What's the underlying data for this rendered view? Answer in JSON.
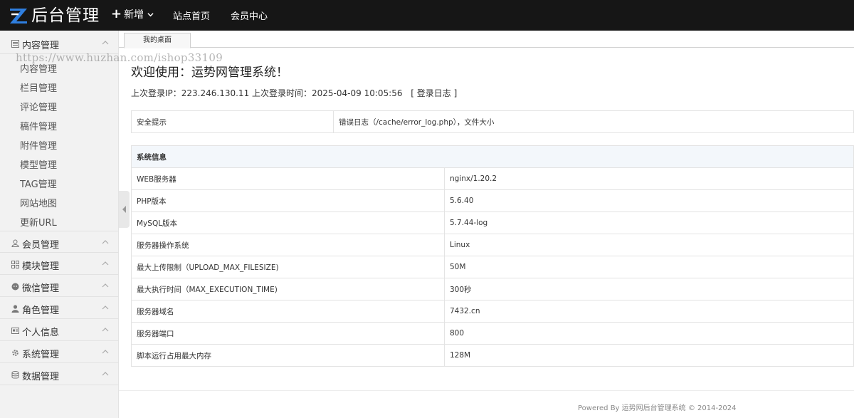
{
  "header": {
    "logo_text": "后台管理",
    "add_label": "新增",
    "nav_links": [
      "站点首页",
      "会员中心"
    ]
  },
  "sidebar": {
    "content_group": {
      "label": "内容管理",
      "icon": "grid-list-icon"
    },
    "content_items": [
      "内容管理",
      "栏目管理",
      "评论管理",
      "稿件管理",
      "附件管理",
      "模型管理",
      "TAG管理",
      "网站地图",
      "更新URL"
    ],
    "groups": [
      {
        "label": "会员管理",
        "icon": "user-icon"
      },
      {
        "label": "模块管理",
        "icon": "modules-icon"
      },
      {
        "label": "微信管理",
        "icon": "wechat-icon"
      },
      {
        "label": "角色管理",
        "icon": "person-icon"
      },
      {
        "label": "个人信息",
        "icon": "id-card-icon"
      },
      {
        "label": "系统管理",
        "icon": "gear-icon"
      },
      {
        "label": "数据管理",
        "icon": "database-icon"
      }
    ]
  },
  "tabs": {
    "active": "我的桌面"
  },
  "watermark": "https://www.huzhan.com/ishop33109",
  "main": {
    "welcome": "欢迎使用：运势网管理系统！",
    "login_info": "上次登录IP：223.246.130.11 上次登录时间：2025-04-09 10:05:56",
    "login_log_link": "[ 登录日志 ]",
    "security": {
      "label": "安全提示",
      "value": "错误日志（/cache/error_log.php），文件大小"
    },
    "sysinfo_title": "系统信息",
    "sysinfo_rows": [
      {
        "k": "WEB服务器",
        "v": "nginx/1.20.2"
      },
      {
        "k": "PHP版本",
        "v": "5.6.40"
      },
      {
        "k": "MySQL版本",
        "v": "5.7.44-log"
      },
      {
        "k": "服务器操作系统",
        "v": "Linux"
      },
      {
        "k": "最大上传限制（UPLOAD_MAX_FILESIZE)",
        "v": "50M"
      },
      {
        "k": "最大执行时间（MAX_EXECUTION_TIME)",
        "v": "300秒"
      },
      {
        "k": "服务器域名",
        "v": "7432.cn"
      },
      {
        "k": "服务器端口",
        "v": "800"
      },
      {
        "k": "脚本运行占用最大内存",
        "v": "128M"
      }
    ]
  },
  "footer": "Powered By 运势网后台管理系统 © 2014-2024"
}
